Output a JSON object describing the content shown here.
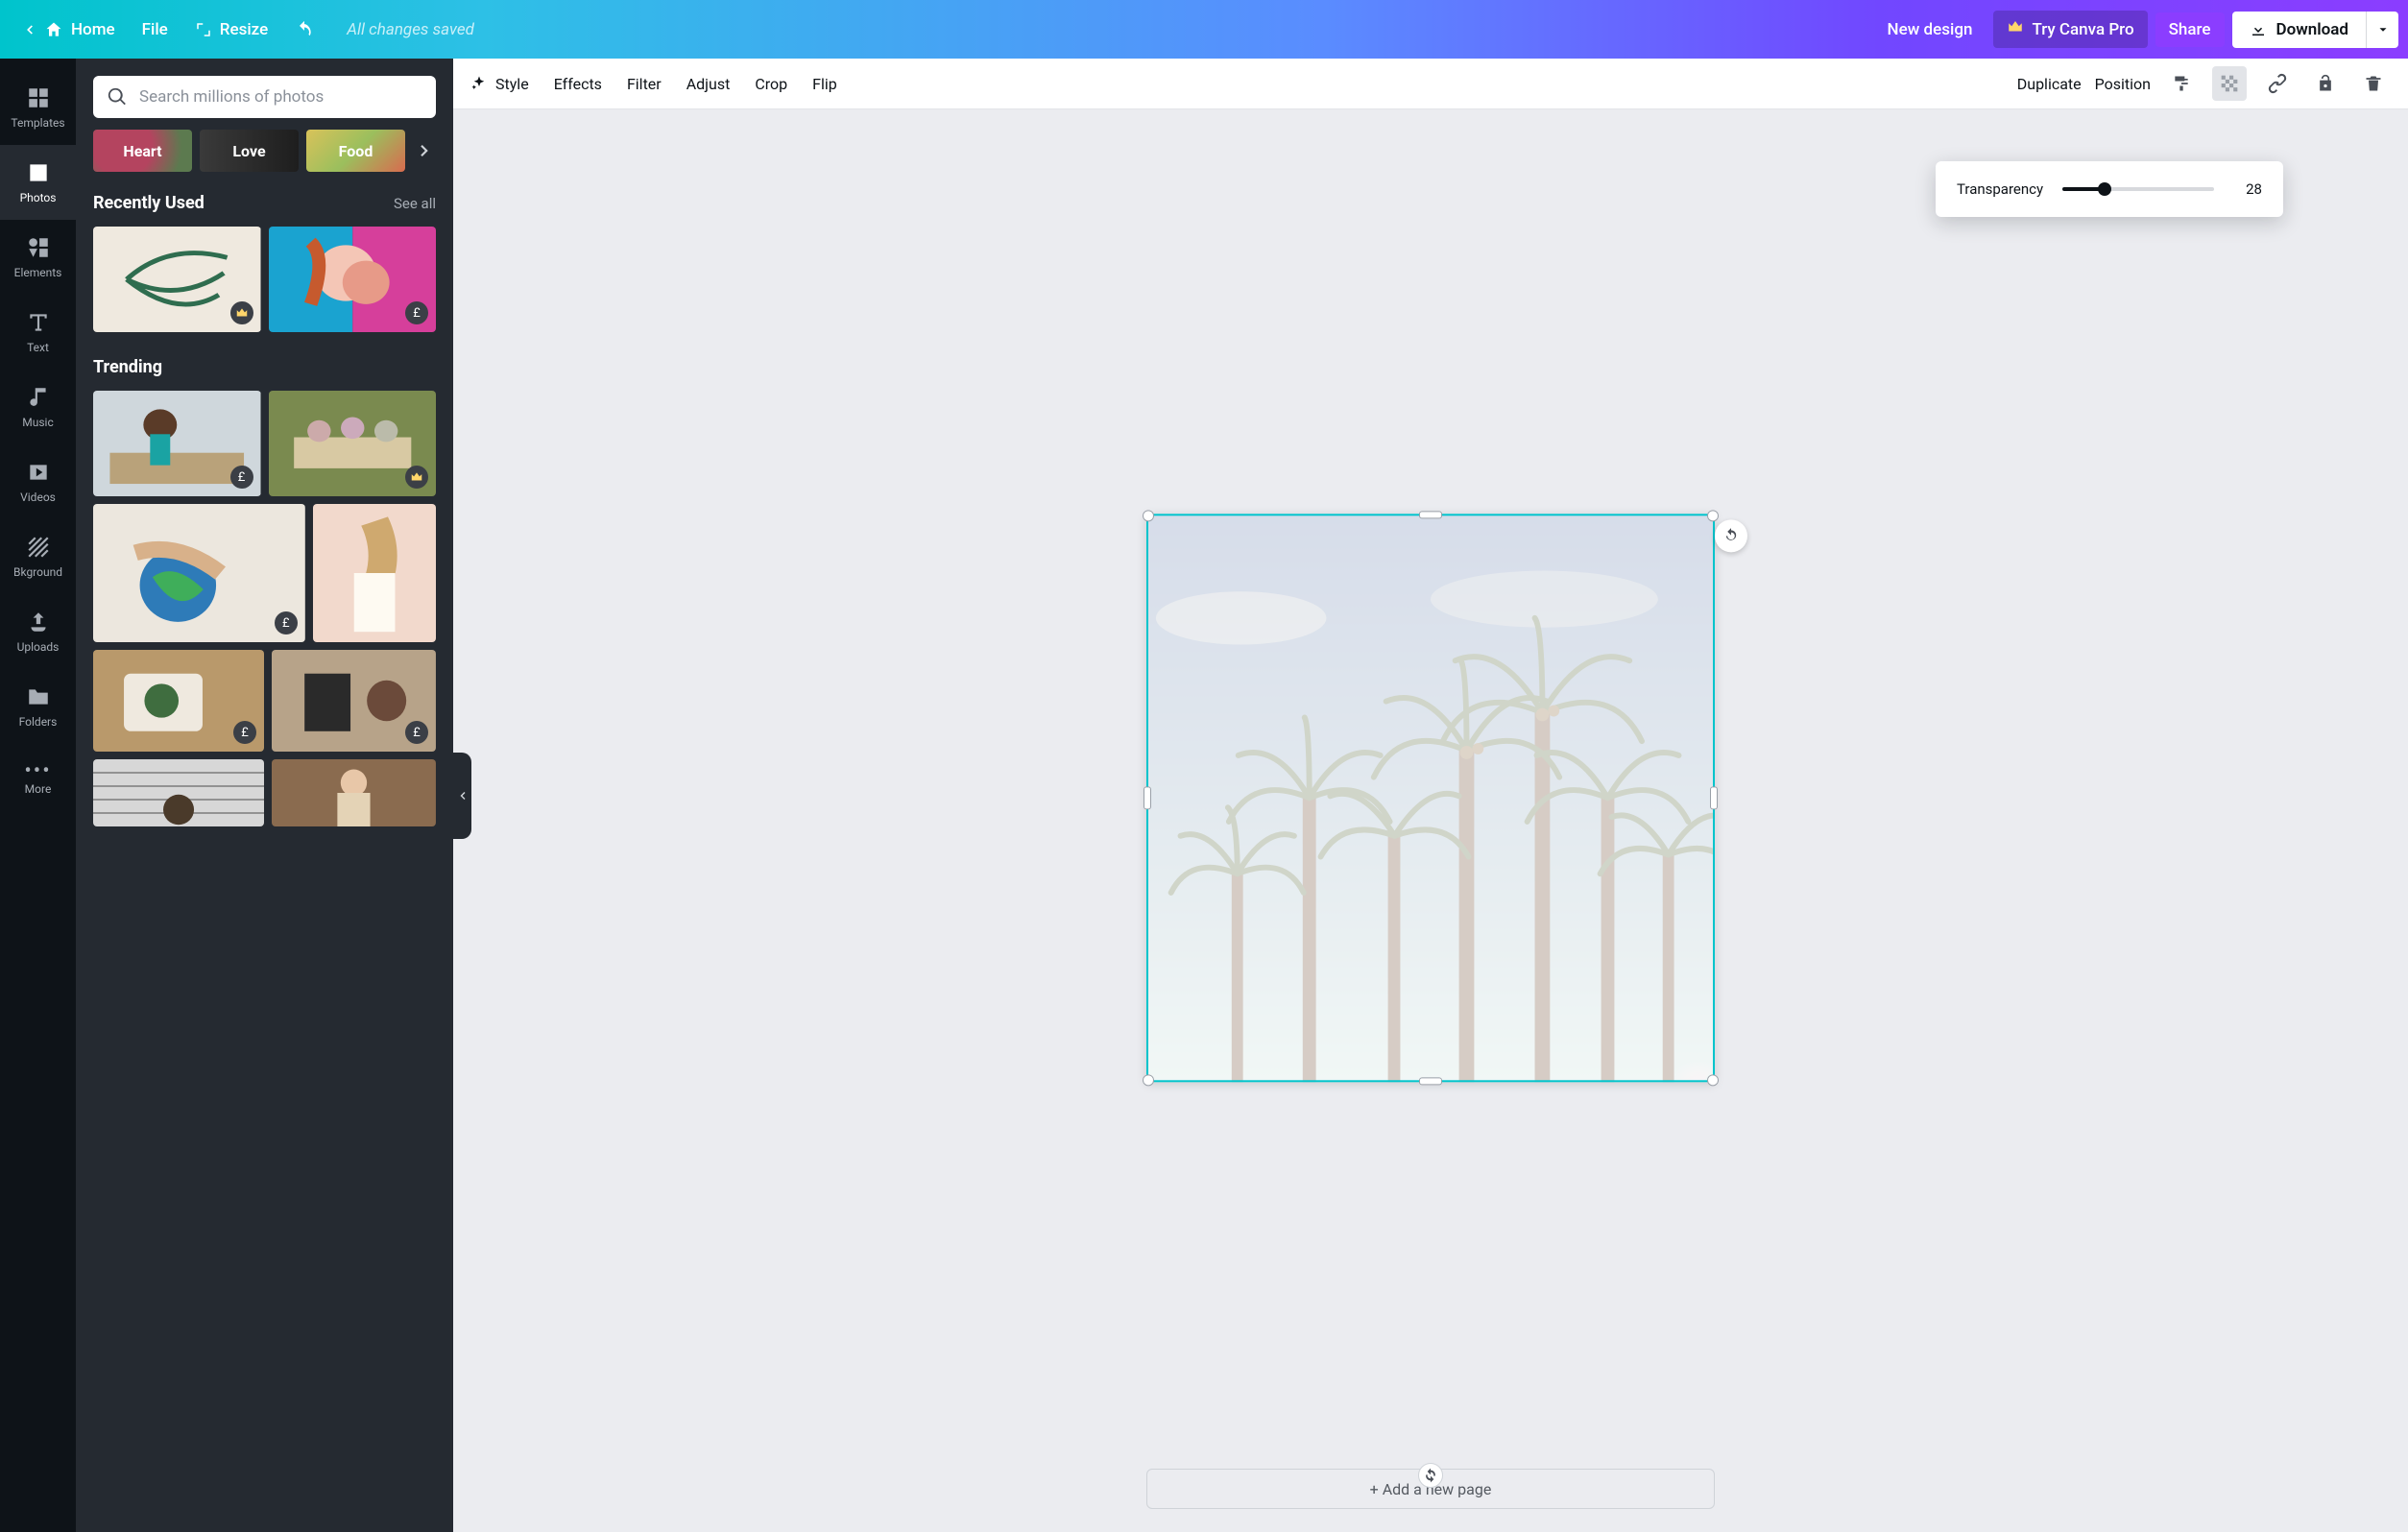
{
  "header": {
    "home": "Home",
    "file": "File",
    "resize": "Resize",
    "status": "All changes saved",
    "new_design": "New design",
    "try_pro": "Try Canva Pro",
    "share": "Share",
    "download": "Download"
  },
  "rail": {
    "templates": "Templates",
    "photos": "Photos",
    "elements": "Elements",
    "text": "Text",
    "music": "Music",
    "videos": "Videos",
    "background": "Bkground",
    "uploads": "Uploads",
    "folders": "Folders",
    "more": "More"
  },
  "panel": {
    "search_placeholder": "Search millions of photos",
    "categories": {
      "heart": "Heart",
      "love": "Love",
      "food": "Food"
    },
    "section_recent": "Recently Used",
    "see_all": "See all",
    "section_trending": "Trending"
  },
  "contextbar": {
    "style": "Style",
    "effects": "Effects",
    "filter": "Filter",
    "adjust": "Adjust",
    "crop": "Crop",
    "flip": "Flip",
    "duplicate": "Duplicate",
    "position": "Position"
  },
  "popover": {
    "label": "Transparency",
    "value": "28",
    "percent": 28
  },
  "canvas": {
    "add_page": "+ Add a new page"
  }
}
